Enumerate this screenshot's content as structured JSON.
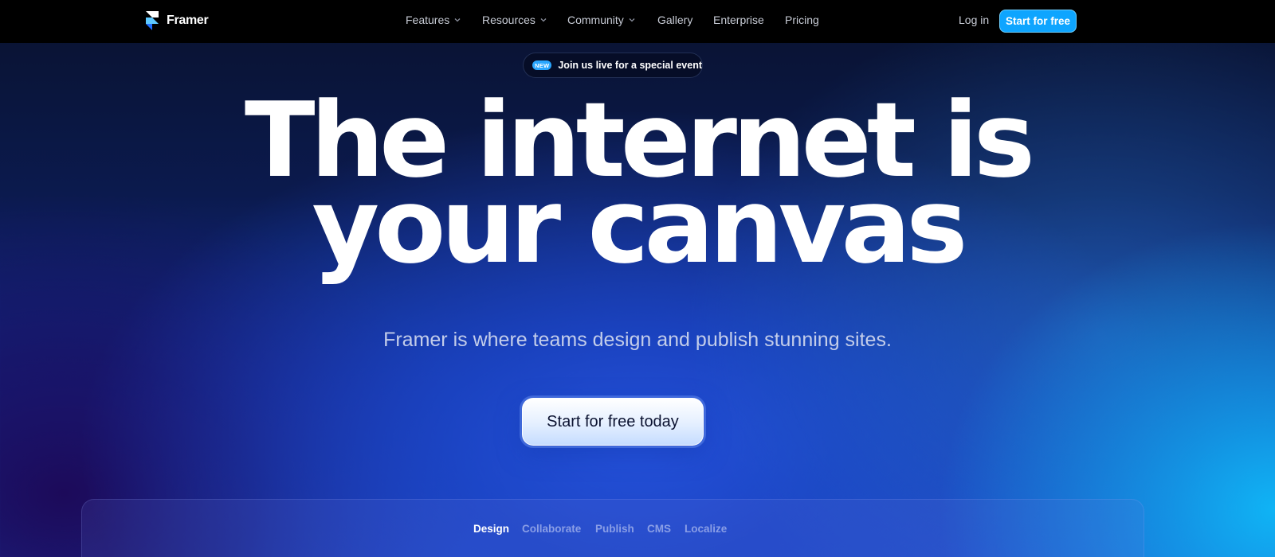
{
  "nav": {
    "logo_text": "Framer",
    "logo_icon": "framer-logo-icon",
    "items": [
      {
        "label": "Features",
        "has_dropdown": true
      },
      {
        "label": "Resources",
        "has_dropdown": true
      },
      {
        "label": "Community",
        "has_dropdown": true
      },
      {
        "label": "Gallery",
        "has_dropdown": false
      },
      {
        "label": "Enterprise",
        "has_dropdown": false
      },
      {
        "label": "Pricing",
        "has_dropdown": false
      }
    ],
    "login": "Log in",
    "cta": "Start for free"
  },
  "announcement": {
    "badge": "NEW",
    "text": "Join us live for a special event"
  },
  "hero": {
    "title_line1": "The internet is",
    "title_line2": "your canvas",
    "subtitle": "Framer is where teams design and publish stunning sites.",
    "cta": "Start for free today"
  },
  "feature_tabs": {
    "active_index": 0,
    "items": [
      "Design",
      "Collaborate",
      "Publish",
      "CMS",
      "Localize"
    ]
  },
  "colors": {
    "accent": "#0ea5ff",
    "nav_background": "#000000"
  }
}
